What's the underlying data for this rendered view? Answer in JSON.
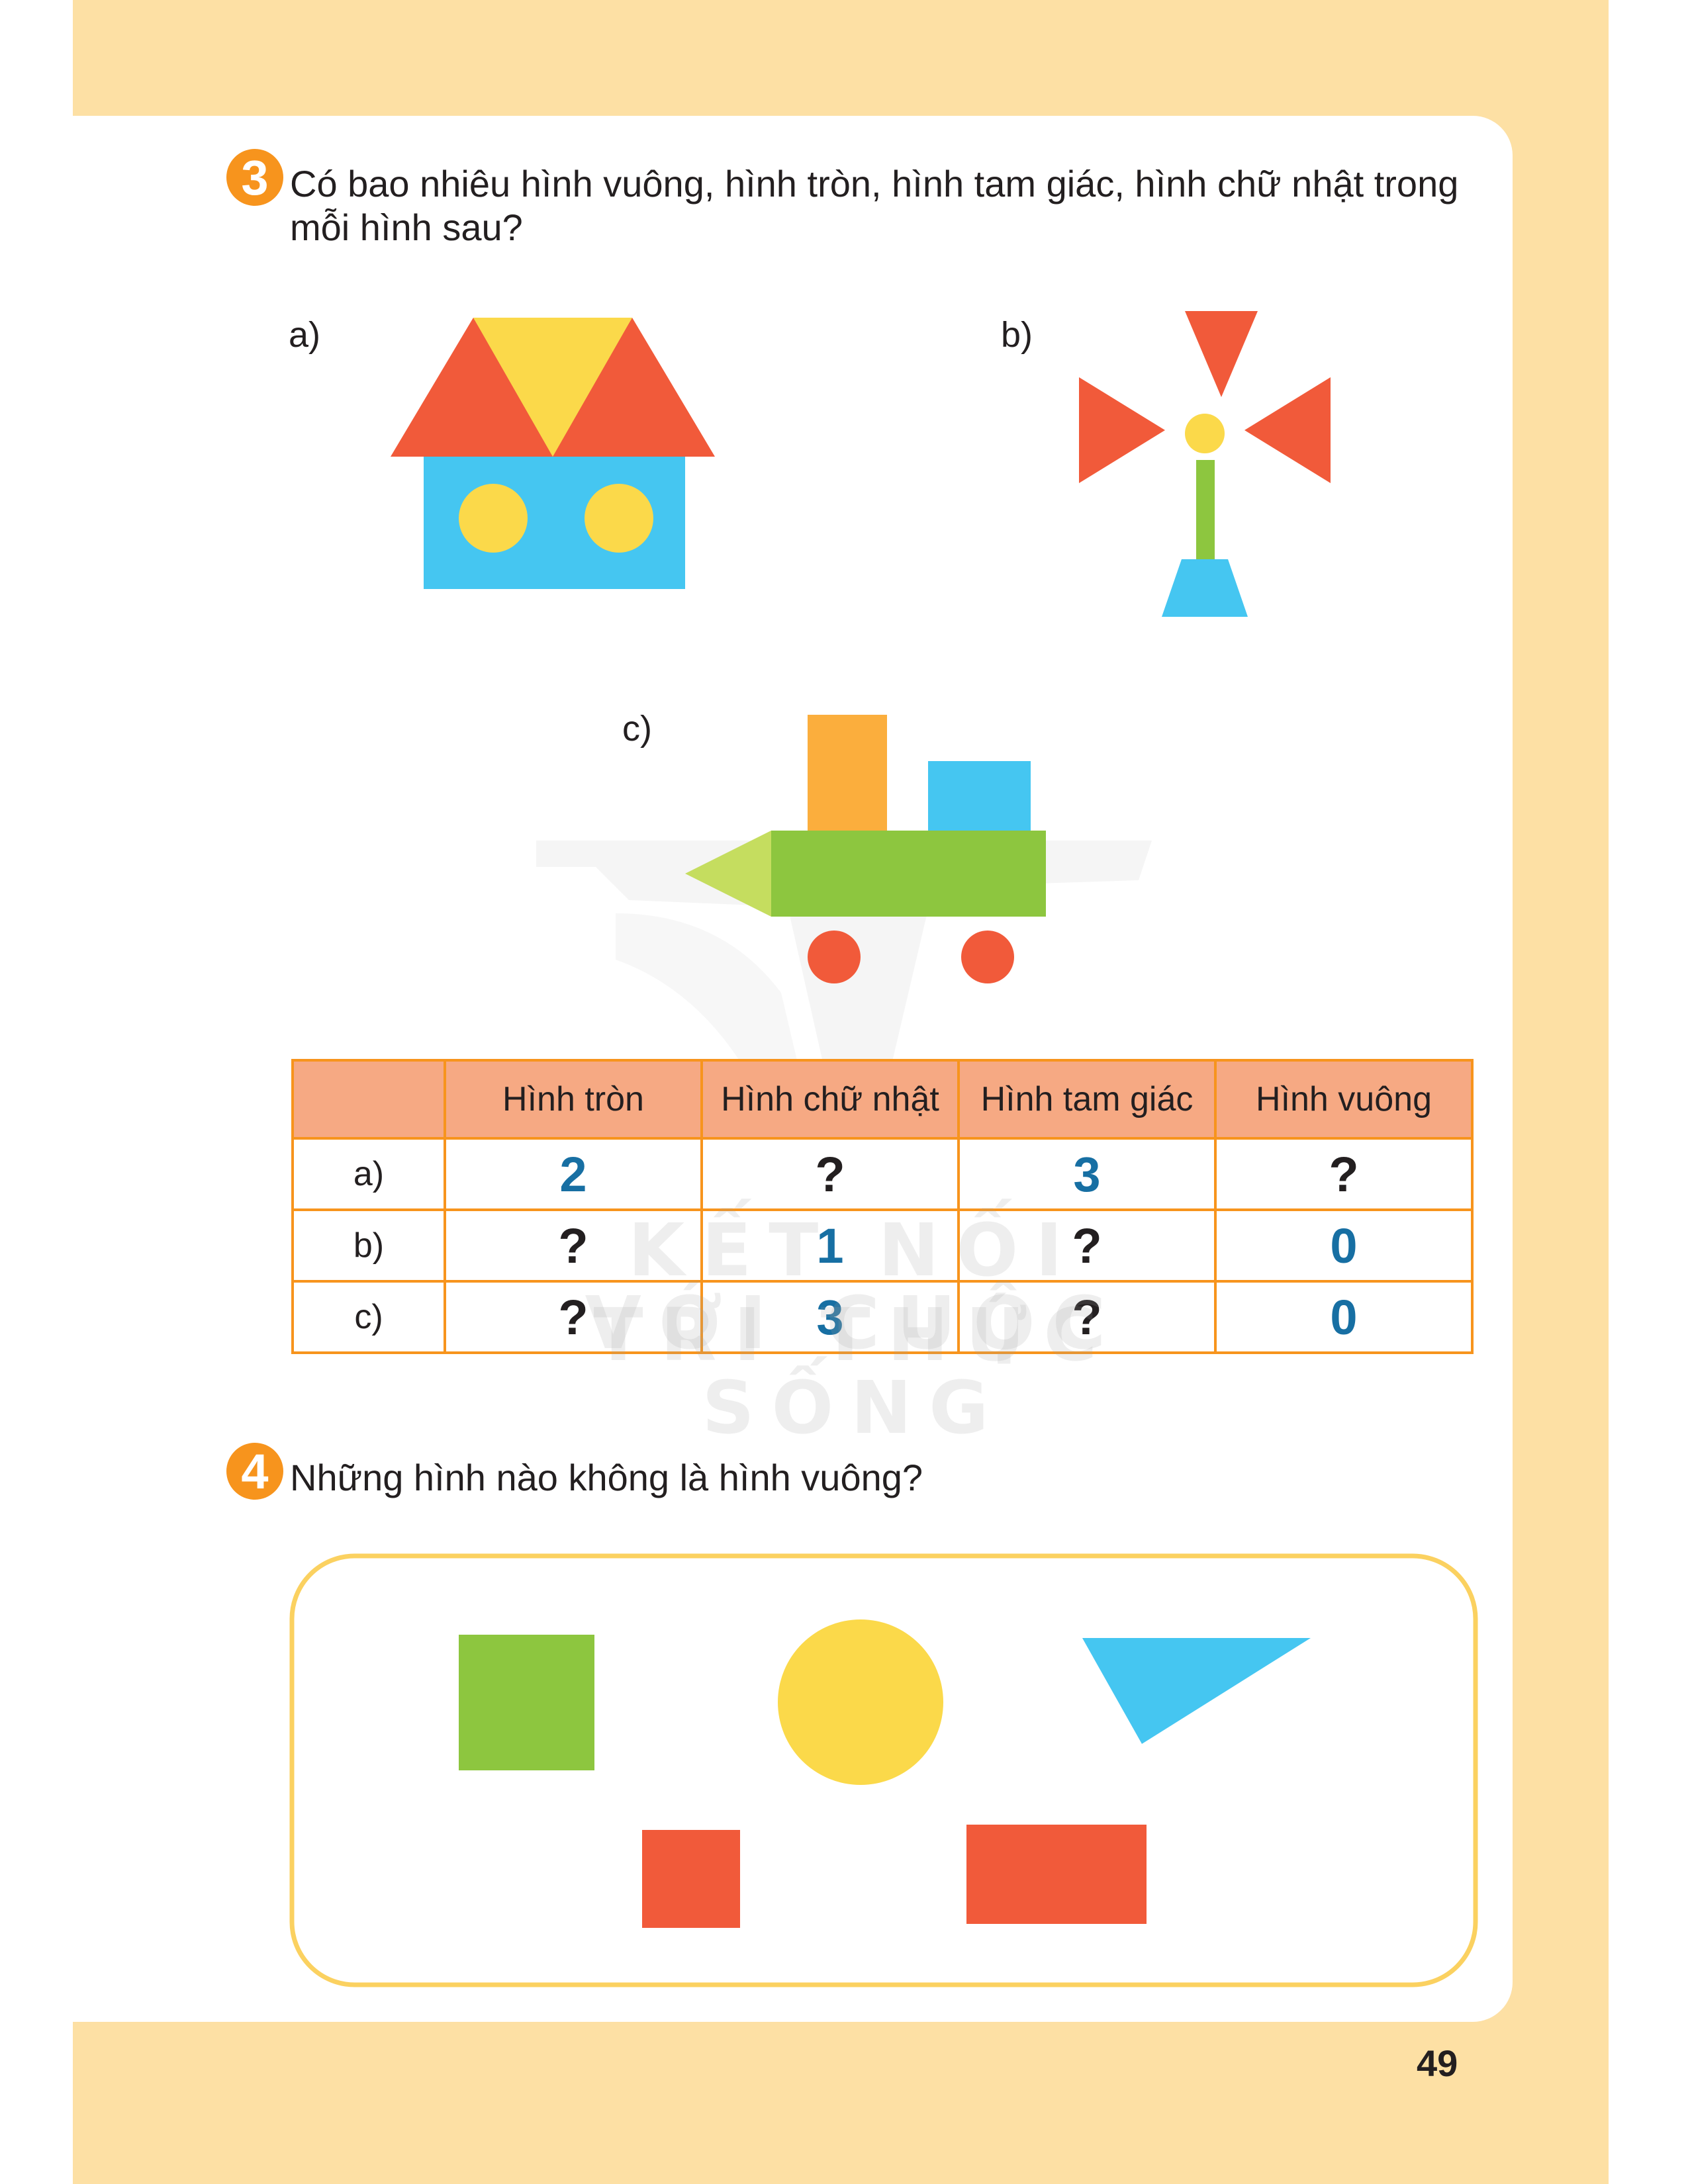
{
  "exercise3": {
    "number": "3",
    "question": "Có bao nhiêu hình vuông, hình tròn, hình tam giác, hình chữ nhật trong mỗi hình sau?",
    "figures": [
      {
        "label": "a)",
        "icon": "house-of-shapes"
      },
      {
        "label": "b)",
        "icon": "pinwheel-of-shapes"
      },
      {
        "label": "c)",
        "icon": "train-of-shapes"
      }
    ],
    "table": {
      "headers": [
        "",
        "Hình tròn",
        "Hình chữ nhật",
        "Hình tam giác",
        "Hình vuông"
      ],
      "rows": [
        {
          "label": "a)",
          "cells": [
            "2",
            "?",
            "3",
            "?"
          ]
        },
        {
          "label": "b)",
          "cells": [
            "?",
            "1",
            "?",
            "0"
          ]
        },
        {
          "label": "c)",
          "cells": [
            "?",
            "3",
            "?",
            "0"
          ]
        }
      ]
    }
  },
  "exercise4": {
    "number": "4",
    "question": "Những hình nào không là hình vuông?",
    "shapes": [
      "green-square",
      "yellow-circle",
      "blue-triangle",
      "red-square",
      "red-rectangle"
    ]
  },
  "watermark": {
    "line1": "KẾT NỐI TRI THỨC",
    "line2": "VỚI CUỘC SỐNG"
  },
  "page_number": "49",
  "colors": {
    "page_background": "#fde0a4",
    "badge": "#f7941d",
    "table_header": "#f6a983",
    "table_border": "#f7941d",
    "answer_text": "#176fa3",
    "red": "#f15a3a",
    "yellow": "#fbd94a",
    "blue": "#45c6f1",
    "green": "#8dc63f",
    "orange": "#fbae3d"
  }
}
